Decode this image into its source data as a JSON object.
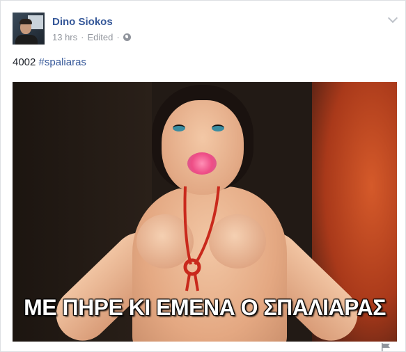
{
  "post": {
    "author": "Dino Siokos",
    "time": "13 hrs",
    "edited": "Edited",
    "separator": "·",
    "text_number": "4002",
    "hashtag": "#spaliaras",
    "image_caption": "ΜΕ ΠΗΡΕ ΚΙ ΕΜΕΝΑ Ο ΣΠΑΛΙΑΡΑΣ"
  },
  "icons": {
    "privacy": "globe-icon",
    "menu": "chevron-down-icon",
    "report": "flag-icon"
  },
  "colors": {
    "link": "#365899",
    "meta": "#90949c",
    "text": "#1d2129"
  }
}
